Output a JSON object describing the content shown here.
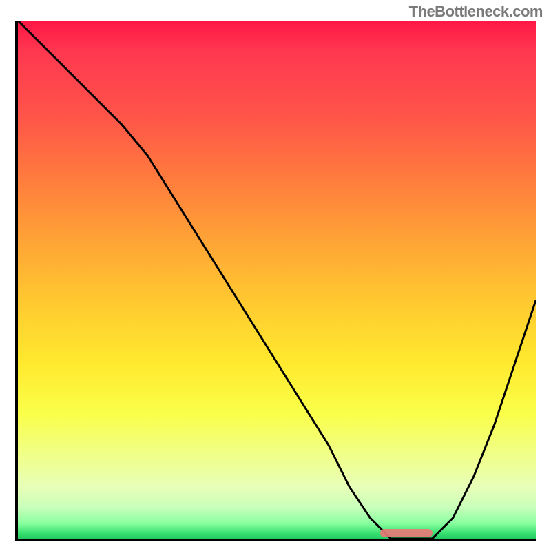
{
  "watermark": "TheBottleneck.com",
  "chart_data": {
    "type": "line",
    "title": "",
    "xlabel": "",
    "ylabel": "",
    "xlim": [
      0,
      100
    ],
    "ylim": [
      0,
      100
    ],
    "x": [
      0,
      5,
      10,
      15,
      20,
      25,
      30,
      35,
      40,
      45,
      50,
      55,
      60,
      64,
      68,
      72,
      76,
      80,
      84,
      88,
      92,
      96,
      100
    ],
    "y": [
      100,
      95,
      90,
      85,
      80,
      74,
      66,
      58,
      50,
      42,
      34,
      26,
      18,
      10,
      4,
      0,
      0,
      0,
      4,
      12,
      22,
      34,
      46
    ],
    "optimal_range": {
      "start": 70,
      "end": 80
    },
    "gradient_stops": [
      {
        "pos": 0,
        "color": "#ff1744"
      },
      {
        "pos": 50,
        "color": "#ffc830"
      },
      {
        "pos": 80,
        "color": "#faff4a"
      },
      {
        "pos": 100,
        "color": "#22c860"
      }
    ]
  }
}
